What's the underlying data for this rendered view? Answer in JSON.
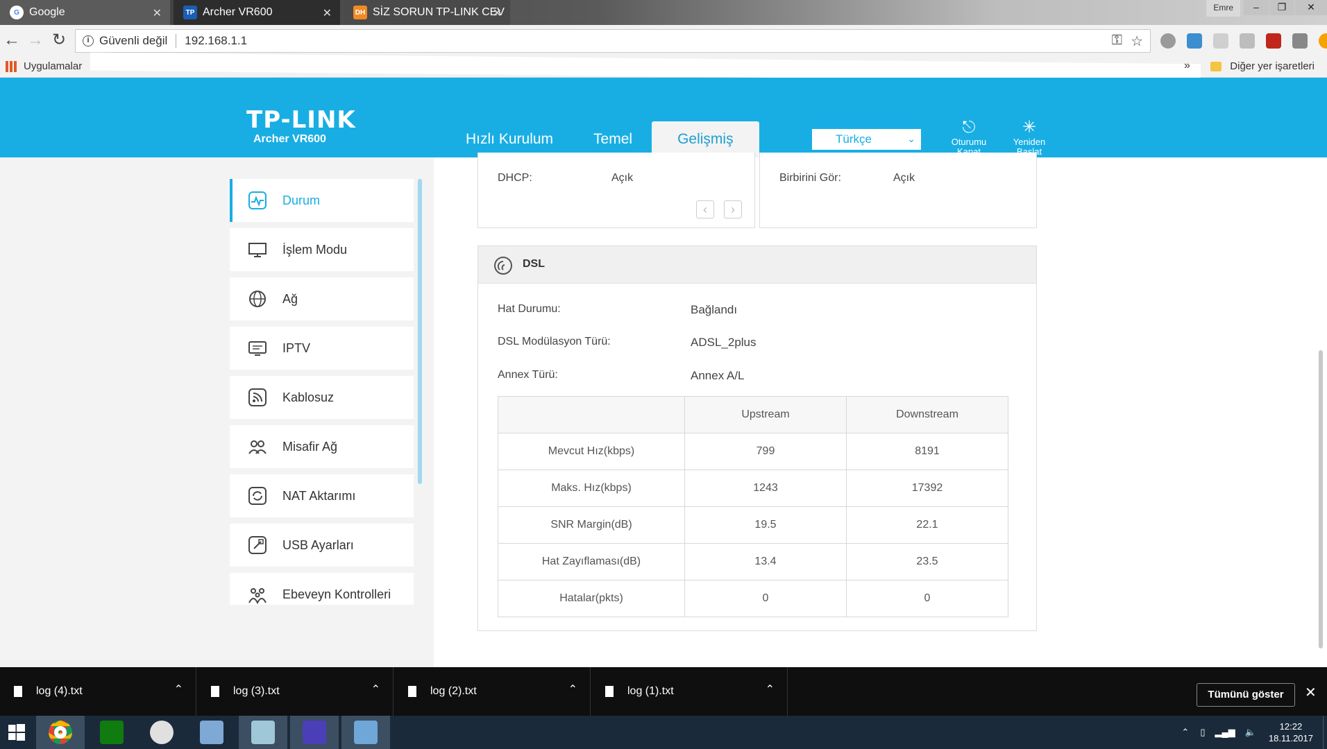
{
  "browser": {
    "tabs": [
      {
        "title": "Google",
        "favicon": "google-icon"
      },
      {
        "title": "Archer VR600",
        "favicon": "tplink-icon"
      },
      {
        "title": "SİZ SORUN TP-LINK CEV",
        "favicon": "dh-icon"
      }
    ],
    "window_user": "Emre",
    "security_label": "Güvenli değil",
    "url": "192.168.1.1",
    "bookmarks": {
      "apps_label": "Uygulamalar",
      "more": "»",
      "other": "Diğer yer işaretleri"
    }
  },
  "router": {
    "brand": "TP-LINK",
    "model": "Archer VR600",
    "nav": [
      "Hızlı Kurulum",
      "Temel",
      "Gelişmiş"
    ],
    "active_nav": "Gelişmiş",
    "language": "Türkçe",
    "logout_label": "Oturumu Kapat",
    "reboot_label": "Yeniden Başlat",
    "accent_color": "#18aee4"
  },
  "sidebar": {
    "items": [
      {
        "label": "Durum",
        "icon": "activity-icon",
        "active": true
      },
      {
        "label": "İşlem Modu",
        "icon": "monitor-icon"
      },
      {
        "label": "Ağ",
        "icon": "globe-icon"
      },
      {
        "label": "IPTV",
        "icon": "tv-icon"
      },
      {
        "label": "Kablosuz",
        "icon": "wireless-icon"
      },
      {
        "label": "Misafir Ağ",
        "icon": "guests-icon"
      },
      {
        "label": "NAT Aktarımı",
        "icon": "nat-icon"
      },
      {
        "label": "USB Ayarları",
        "icon": "usb-icon"
      },
      {
        "label": "Ebeveyn Kontrolleri",
        "icon": "family-icon"
      }
    ]
  },
  "lan_panel": {
    "dhcp_label": "DHCP:",
    "dhcp_value": "Açık"
  },
  "wifi_panel": {
    "label": "Birbirini Gör:",
    "value": "Açık"
  },
  "dsl": {
    "title": "DSL",
    "line_status_label": "Hat Durumu:",
    "line_status": "Bağlandı",
    "modulation_label": "DSL Modülasyon Türü:",
    "modulation": "ADSL_2plus",
    "annex_label": "Annex Türü:",
    "annex": "Annex A/L",
    "table": {
      "headers": [
        "",
        "Upstream",
        "Downstream"
      ],
      "rows": [
        [
          "Mevcut Hız(kbps)",
          "799",
          "8191"
        ],
        [
          "Maks. Hız(kbps)",
          "1243",
          "17392"
        ],
        [
          "SNR Margin(dB)",
          "19.5",
          "22.1"
        ],
        [
          "Hat Zayıflaması(dB)",
          "13.4",
          "23.5"
        ],
        [
          "Hatalar(pkts)",
          "0",
          "0"
        ]
      ]
    }
  },
  "downloads": {
    "files": [
      "log (4).txt",
      "log (3).txt",
      "log (2).txt",
      "log (1).txt"
    ],
    "show_all": "Tümünü göster"
  },
  "taskbar": {
    "time": "12:22",
    "date": "18.11.2017"
  }
}
